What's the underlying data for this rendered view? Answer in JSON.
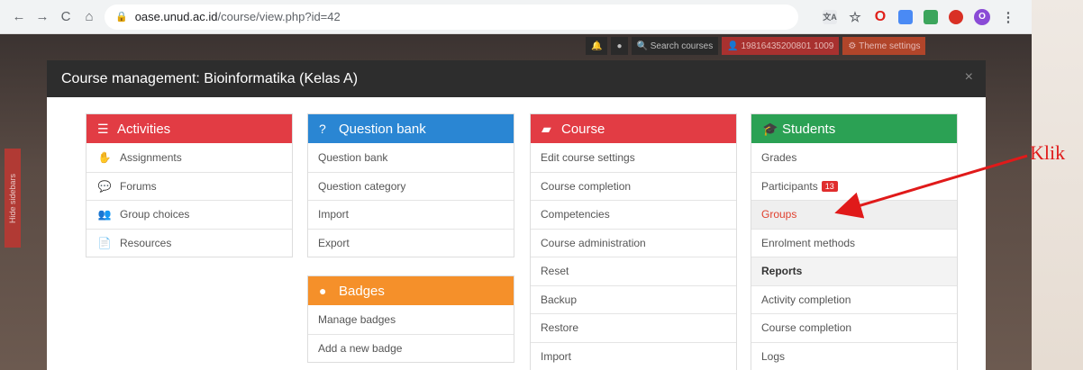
{
  "browser": {
    "url_host": "oase.unud.ac.id",
    "url_path": "/course/view.php?id=42",
    "nav": {
      "back": "←",
      "forward": "→",
      "reload": "C",
      "home": "⌂"
    },
    "avatar_letter": "O"
  },
  "page": {
    "topbar": {
      "search": "Search courses",
      "user": "19816435200801 1009",
      "theme": "Theme settings"
    },
    "hide_sidebars": "Hide sidebars"
  },
  "modal": {
    "title": "Course management: Bioinformatika (Kelas A)",
    "close": "×",
    "activities": {
      "title": "Activities",
      "items": [
        "Assignments",
        "Forums",
        "Group choices",
        "Resources"
      ]
    },
    "question_bank": {
      "title": "Question bank",
      "items": [
        "Question bank",
        "Question category",
        "Import",
        "Export"
      ]
    },
    "badges": {
      "title": "Badges",
      "items": [
        "Manage badges",
        "Add a new badge"
      ]
    },
    "course": {
      "title": "Course",
      "items": [
        "Edit course settings",
        "Course completion",
        "Competencies",
        "Course administration",
        "Reset",
        "Backup",
        "Restore",
        "Import"
      ]
    },
    "students": {
      "title": "Students",
      "grades": "Grades",
      "participants": "Participants",
      "participants_count": "13",
      "groups": "Groups",
      "enrolment": "Enrolment methods",
      "reports_header": "Reports",
      "activity_completion": "Activity completion",
      "course_completion": "Course completion",
      "logs": "Logs"
    }
  },
  "annotation": {
    "text": "Klik",
    "color": "#e01a1a"
  },
  "colors": {
    "red": "#e23c44",
    "blue": "#2a86d3",
    "green": "#2ba154",
    "orange": "#f5902a"
  }
}
